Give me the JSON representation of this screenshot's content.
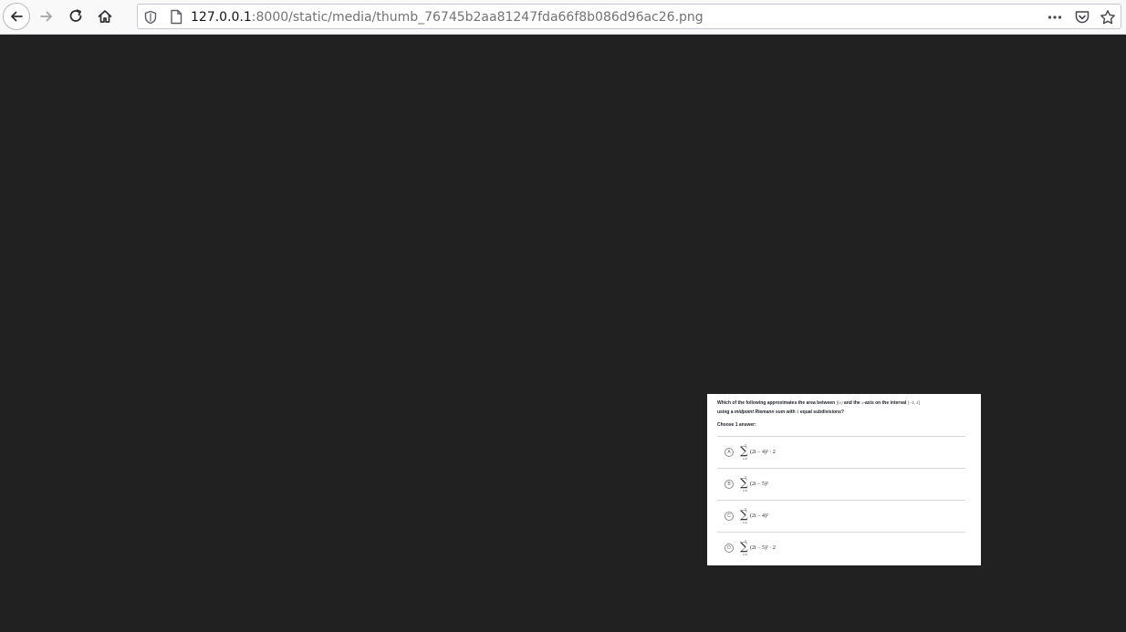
{
  "browser": {
    "url_host": "127.0.0.1",
    "url_rest": ":8000/static/media/thumb_76745b2aa81247fda66f8b086d96ac26.png",
    "icons": [
      "back-arrow-icon",
      "forward-arrow-icon",
      "reload-icon",
      "home-icon",
      "shield-icon",
      "page-icon",
      "more-dots-icon",
      "pocket-icon",
      "bookmark-star-icon"
    ]
  },
  "question": {
    "line1_a": "Which of the following approximates the area between ",
    "fx": "f(x)",
    "line1_b": " and the ",
    "xvar": "x",
    "line1_c": "-axis on the interval ",
    "interval": "[−4, 4]",
    "line2_a": "using a ",
    "method": "midpoint Riemann sum",
    "line2_b": " with ",
    "count": "4",
    "line2_c": " equal subdivisions?",
    "choose_label": "Choose 1 answer:"
  },
  "choices": [
    {
      "letter": "A",
      "top": "3",
      "sigma": "∑",
      "bottom": "i=0",
      "expr": "(2i − 4)² · 2"
    },
    {
      "letter": "B",
      "top": "3",
      "sigma": "∑",
      "bottom": "i=0",
      "expr": "(2i − 5)²"
    },
    {
      "letter": "C",
      "top": "3",
      "sigma": "∑",
      "bottom": "i=0",
      "expr": "(2i − 4)²"
    },
    {
      "letter": "D",
      "top": "3",
      "sigma": "∑",
      "bottom": "i=0",
      "expr": "(2i − 5)² · 2"
    }
  ],
  "colors": {
    "chrome": "#f9f9fa",
    "viewer_background": "#212121",
    "card": "#ffffff"
  }
}
